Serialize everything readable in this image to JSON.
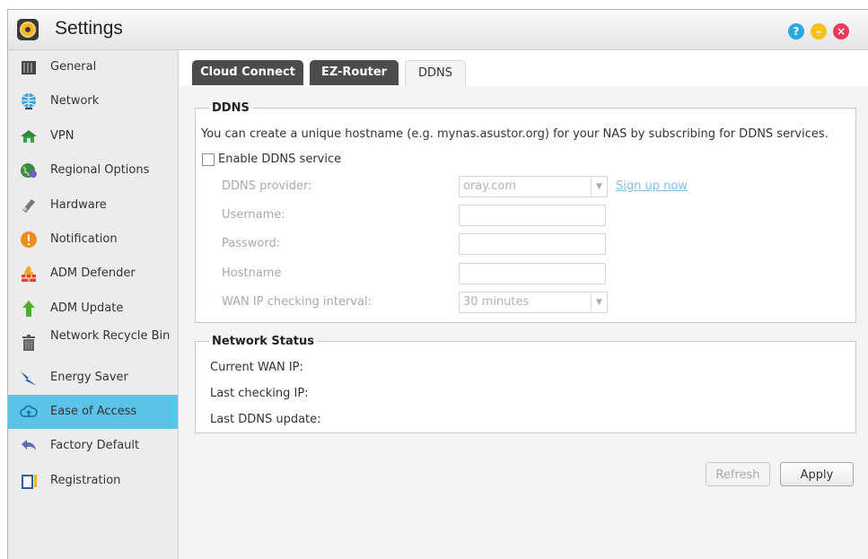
{
  "window": {
    "title": "Settings",
    "controls": {
      "help": "?",
      "minimize": "–",
      "close": "×"
    },
    "colors": {
      "accent": "#59c3e8",
      "tab_dark": "#4c4c4c",
      "help": "#2aa8e0",
      "minimize": "#f4c21b",
      "close": "#ee3a5a"
    }
  },
  "sidebar": {
    "items": [
      {
        "label": "General",
        "icon": "server-icon",
        "active": false
      },
      {
        "label": "Network",
        "icon": "globe-icon",
        "active": false
      },
      {
        "label": "VPN",
        "icon": "vpn-house-icon",
        "active": false
      },
      {
        "label": "Regional Options",
        "icon": "globe-pin-icon",
        "active": false
      },
      {
        "label": "Hardware",
        "icon": "hardware-icon",
        "active": false
      },
      {
        "label": "Notification",
        "icon": "alert-icon",
        "active": false
      },
      {
        "label": "ADM Defender",
        "icon": "firewall-icon",
        "active": false
      },
      {
        "label": "ADM Update",
        "icon": "update-arrow-icon",
        "active": false
      },
      {
        "label": "Network Recycle Bin",
        "icon": "trash-icon",
        "active": false
      },
      {
        "label": "Energy Saver",
        "icon": "lightning-icon",
        "active": false
      },
      {
        "label": "Ease of Access",
        "icon": "cloud-upload-icon",
        "active": true
      },
      {
        "label": "Factory Default",
        "icon": "undo-arrow-icon",
        "active": false
      },
      {
        "label": "Registration",
        "icon": "clipboard-icon",
        "active": false
      }
    ]
  },
  "tabs": [
    {
      "label": "Cloud Connect",
      "selected": false
    },
    {
      "label": "EZ-Router",
      "selected": false
    },
    {
      "label": "DDNS",
      "selected": true
    }
  ],
  "ddns": {
    "legend": "DDNS",
    "description": "You can create a unique hostname (e.g. mynas.asustor.org) for your NAS by subscribing for DDNS services.",
    "enable_label": "Enable DDNS service",
    "enable_checked": false,
    "provider_label": "DDNS provider:",
    "provider_value": "oray.com",
    "signup_link": "Sign up now",
    "username_label": "Username:",
    "username_value": "",
    "password_label": "Password:",
    "password_value": "",
    "hostname_label": "Hostname",
    "hostname_value": "",
    "interval_label": "WAN IP checking interval:",
    "interval_value": "30 minutes"
  },
  "status": {
    "legend": "Network Status",
    "wan_ip_label": "Current WAN IP:",
    "last_check_label": "Last checking IP:",
    "last_update_label": "Last DDNS update:"
  },
  "buttons": {
    "refresh": "Refresh",
    "apply": "Apply"
  }
}
